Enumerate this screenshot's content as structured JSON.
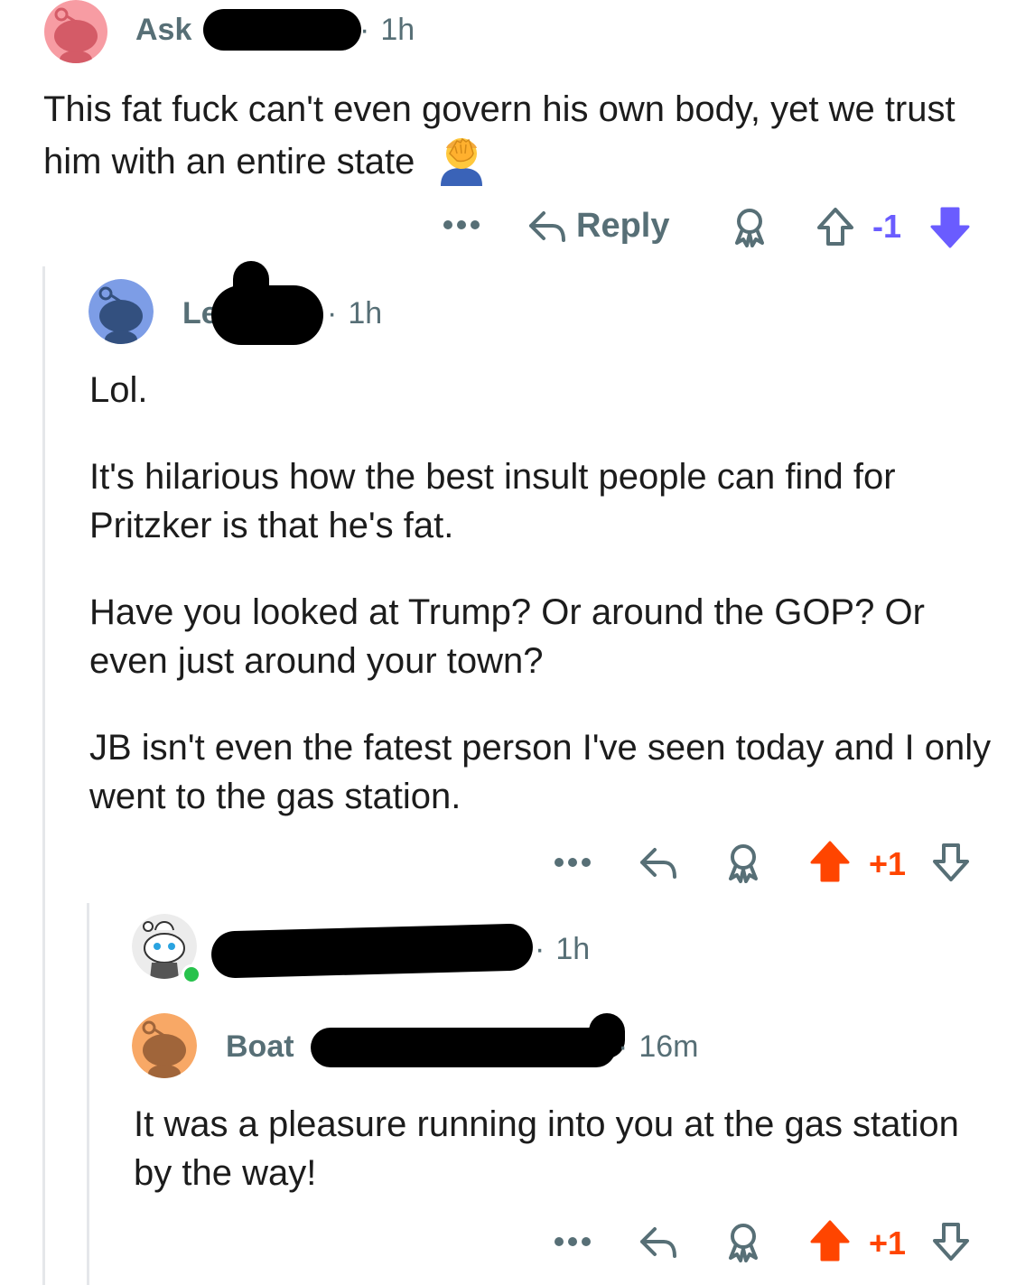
{
  "colors": {
    "muted": "#576f76",
    "upvote": "#ff4500",
    "downvote": "#6a5cff",
    "thread": "#e5e7ea"
  },
  "comment1": {
    "username": "Ask",
    "time": "1h",
    "text": "This fat fuck can't even govern his own body, yet we trust him with an entire state",
    "emoji": "facepalm",
    "actions": {
      "reply_label": "Reply",
      "score": "-1",
      "vote_state": "downvoted"
    }
  },
  "comment2": {
    "username": "Le",
    "time": "1h",
    "paragraphs": [
      "Lol.",
      "It's hilarious how the best insult people can find for Pritzker is that he's fat.",
      "Have you looked at Trump? Or around the GOP? Or even just around your town?",
      "JB isn't even the fatest person I've seen today and I only went to the gas station."
    ],
    "actions": {
      "score": "+1",
      "vote_state": "upvoted"
    }
  },
  "comment3": {
    "username": "",
    "time": "1h",
    "online": true
  },
  "comment4": {
    "username": "Boat",
    "time": "16m",
    "text": "It was a pleasure running into you at the gas station by the way!",
    "actions": {
      "score": "+1",
      "vote_state": "upvoted"
    }
  }
}
